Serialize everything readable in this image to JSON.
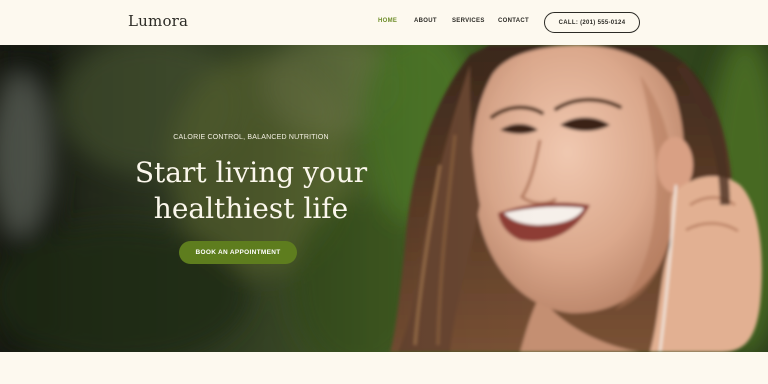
{
  "header": {
    "logo": "Lumora",
    "nav": [
      {
        "label": "HOME",
        "active": true
      },
      {
        "label": "ABOUT",
        "active": false
      },
      {
        "label": "SERVICES",
        "active": false
      },
      {
        "label": "CONTACT",
        "active": false
      }
    ],
    "call_label": "CALL: (201) 555-0124"
  },
  "hero": {
    "eyebrow": "CALORIE CONTROL, BALANCED NUTRITION",
    "headline_line1": "Start living your",
    "headline_line2": "healthiest life",
    "cta_label": "BOOK AN APPOINTMENT",
    "image": "smiling-woman-with-earphones-photo"
  },
  "colors": {
    "background": "#fdf9ef",
    "accent": "#6f8e2a",
    "button": "#5e7d1e",
    "text_dark": "#2c2b26",
    "text_light": "#fbf7ec"
  }
}
